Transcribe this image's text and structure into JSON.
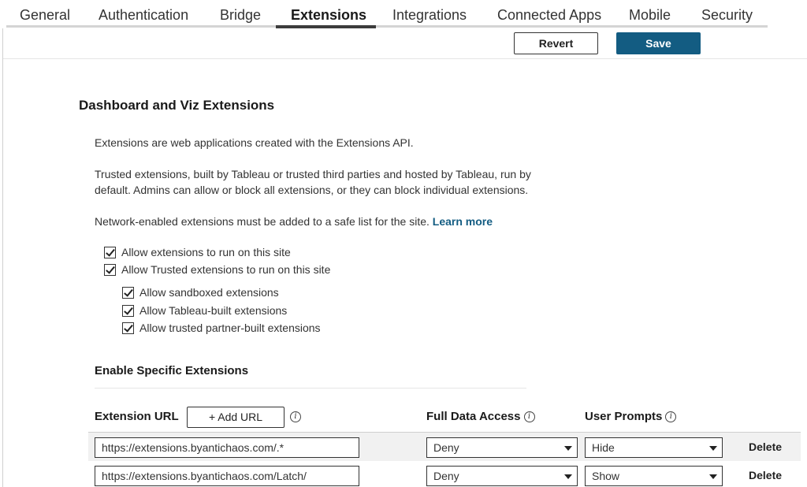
{
  "tabs": [
    {
      "label": "General"
    },
    {
      "label": "Authentication"
    },
    {
      "label": "Bridge"
    },
    {
      "label": "Extensions",
      "active": true
    },
    {
      "label": "Integrations"
    },
    {
      "label": "Connected Apps"
    },
    {
      "label": "Mobile"
    },
    {
      "label": "Security"
    }
  ],
  "toolbar": {
    "revert_label": "Revert",
    "save_label": "Save"
  },
  "section": {
    "title": "Dashboard and Viz Extensions",
    "para1": "Extensions are web applications created with the Extensions API.",
    "para2": "Trusted extensions, built by Tableau or trusted third parties and hosted by Tableau, run by default. Admins can allow or block all extensions, or they can block individual extensions.",
    "para3": "Network-enabled extensions must be added to a safe list for the site. ",
    "learn_more": "Learn more"
  },
  "checkboxes": {
    "allow_run": {
      "label": "Allow extensions to run on this site",
      "checked": true
    },
    "allow_trusted": {
      "label": "Allow Trusted extensions to run on this site",
      "checked": true
    },
    "sandboxed": {
      "label": "Allow sandboxed extensions",
      "checked": true
    },
    "tableau_built": {
      "label": "Allow Tableau-built extensions",
      "checked": true
    },
    "partner_built": {
      "label": "Allow trusted partner-built extensions",
      "checked": true
    }
  },
  "specific": {
    "title": "Enable Specific Extensions",
    "col_url": "Extension URL",
    "add_url_label": "+ Add URL",
    "col_access": "Full Data Access",
    "col_prompts": "User Prompts",
    "info_glyph": "i",
    "rows": [
      {
        "url": "https://extensions.byantichaos.com/.*",
        "access": "Deny",
        "prompts": "Hide",
        "delete_label": "Delete"
      },
      {
        "url": "https://extensions.byantichaos.com/Latch/",
        "access": "Deny",
        "prompts": "Show",
        "delete_label": "Delete"
      }
    ]
  }
}
